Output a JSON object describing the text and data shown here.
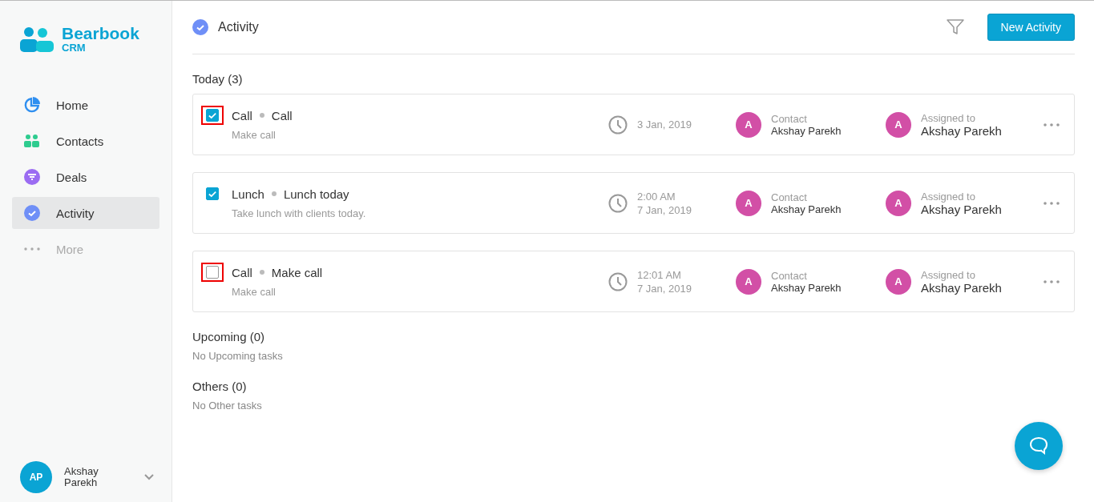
{
  "brand": {
    "name": "Bearbook",
    "sub": "CRM"
  },
  "nav": [
    {
      "label": "Home",
      "selected": false,
      "disabled": false
    },
    {
      "label": "Contacts",
      "selected": false,
      "disabled": false
    },
    {
      "label": "Deals",
      "selected": false,
      "disabled": false
    },
    {
      "label": "Activity",
      "selected": true,
      "disabled": false
    },
    {
      "label": "More",
      "selected": false,
      "disabled": true
    }
  ],
  "user": {
    "initials": "AP",
    "name": "Akshay Parekh"
  },
  "header": {
    "title": "Activity",
    "button": "New Activity"
  },
  "sections": [
    {
      "title": "Today (3)",
      "items": [
        {
          "checked": true,
          "highlighted": true,
          "type": "Call",
          "title": "Call",
          "description": "Make call",
          "time": [
            "3 Jan, 2019"
          ],
          "contact": {
            "label": "Contact",
            "initial": "A",
            "name": "Akshay Parekh"
          },
          "assignee": {
            "label": "Assigned to",
            "initial": "A",
            "name": "Akshay Parekh"
          }
        },
        {
          "checked": true,
          "highlighted": false,
          "type": "Lunch",
          "title": "Lunch today",
          "description": "Take lunch with clients today.",
          "time": [
            "2:00 AM",
            "7 Jan, 2019"
          ],
          "contact": {
            "label": "Contact",
            "initial": "A",
            "name": "Akshay Parekh"
          },
          "assignee": {
            "label": "Assigned to",
            "initial": "A",
            "name": "Akshay Parekh"
          }
        },
        {
          "checked": false,
          "highlighted": true,
          "type": "Call",
          "title": "Make call",
          "description": "Make call",
          "time": [
            "12:01 AM",
            "7 Jan, 2019"
          ],
          "contact": {
            "label": "Contact",
            "initial": "A",
            "name": "Akshay Parekh"
          },
          "assignee": {
            "label": "Assigned to",
            "initial": "A",
            "name": "Akshay Parekh"
          }
        }
      ]
    },
    {
      "title": "Upcoming (0)",
      "empty": "No Upcoming tasks"
    },
    {
      "title": "Others (0)",
      "empty": "No Other tasks"
    }
  ]
}
